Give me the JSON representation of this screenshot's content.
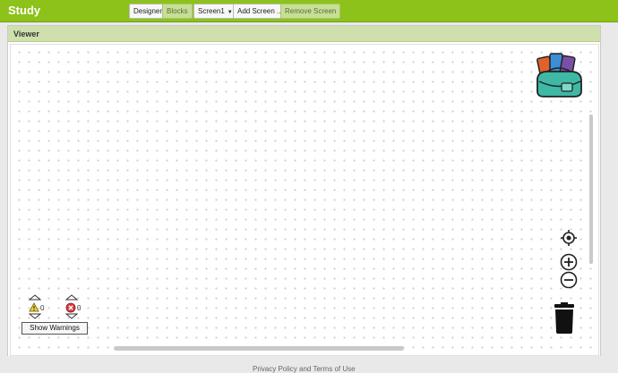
{
  "app": {
    "title": "Study"
  },
  "toolbar": {
    "designer_label": "Designer",
    "blocks_label": "Blocks",
    "screen_select_value": "Screen1",
    "add_screen_label": "Add Screen ...",
    "remove_screen_label": "Remove Screen"
  },
  "viewer": {
    "title": "Viewer"
  },
  "warnings": {
    "warning_count": "0",
    "error_count": "0",
    "show_warnings_label": "Show Warnings"
  },
  "footer": {
    "link_text": "Privacy Policy and Terms of Use"
  },
  "colors": {
    "appbar": "#8dc21b",
    "viewer_header": "#cfe0ad",
    "backpack_orange": "#e0622a",
    "backpack_blue": "#3b8fd6",
    "backpack_purple": "#7a4fa8",
    "backpack_teal": "#3fb8a6"
  },
  "icons": [
    "backpack-icon",
    "recenter-icon",
    "zoom-in-icon",
    "zoom-out-icon",
    "trash-icon",
    "warning-icon",
    "error-icon"
  ]
}
